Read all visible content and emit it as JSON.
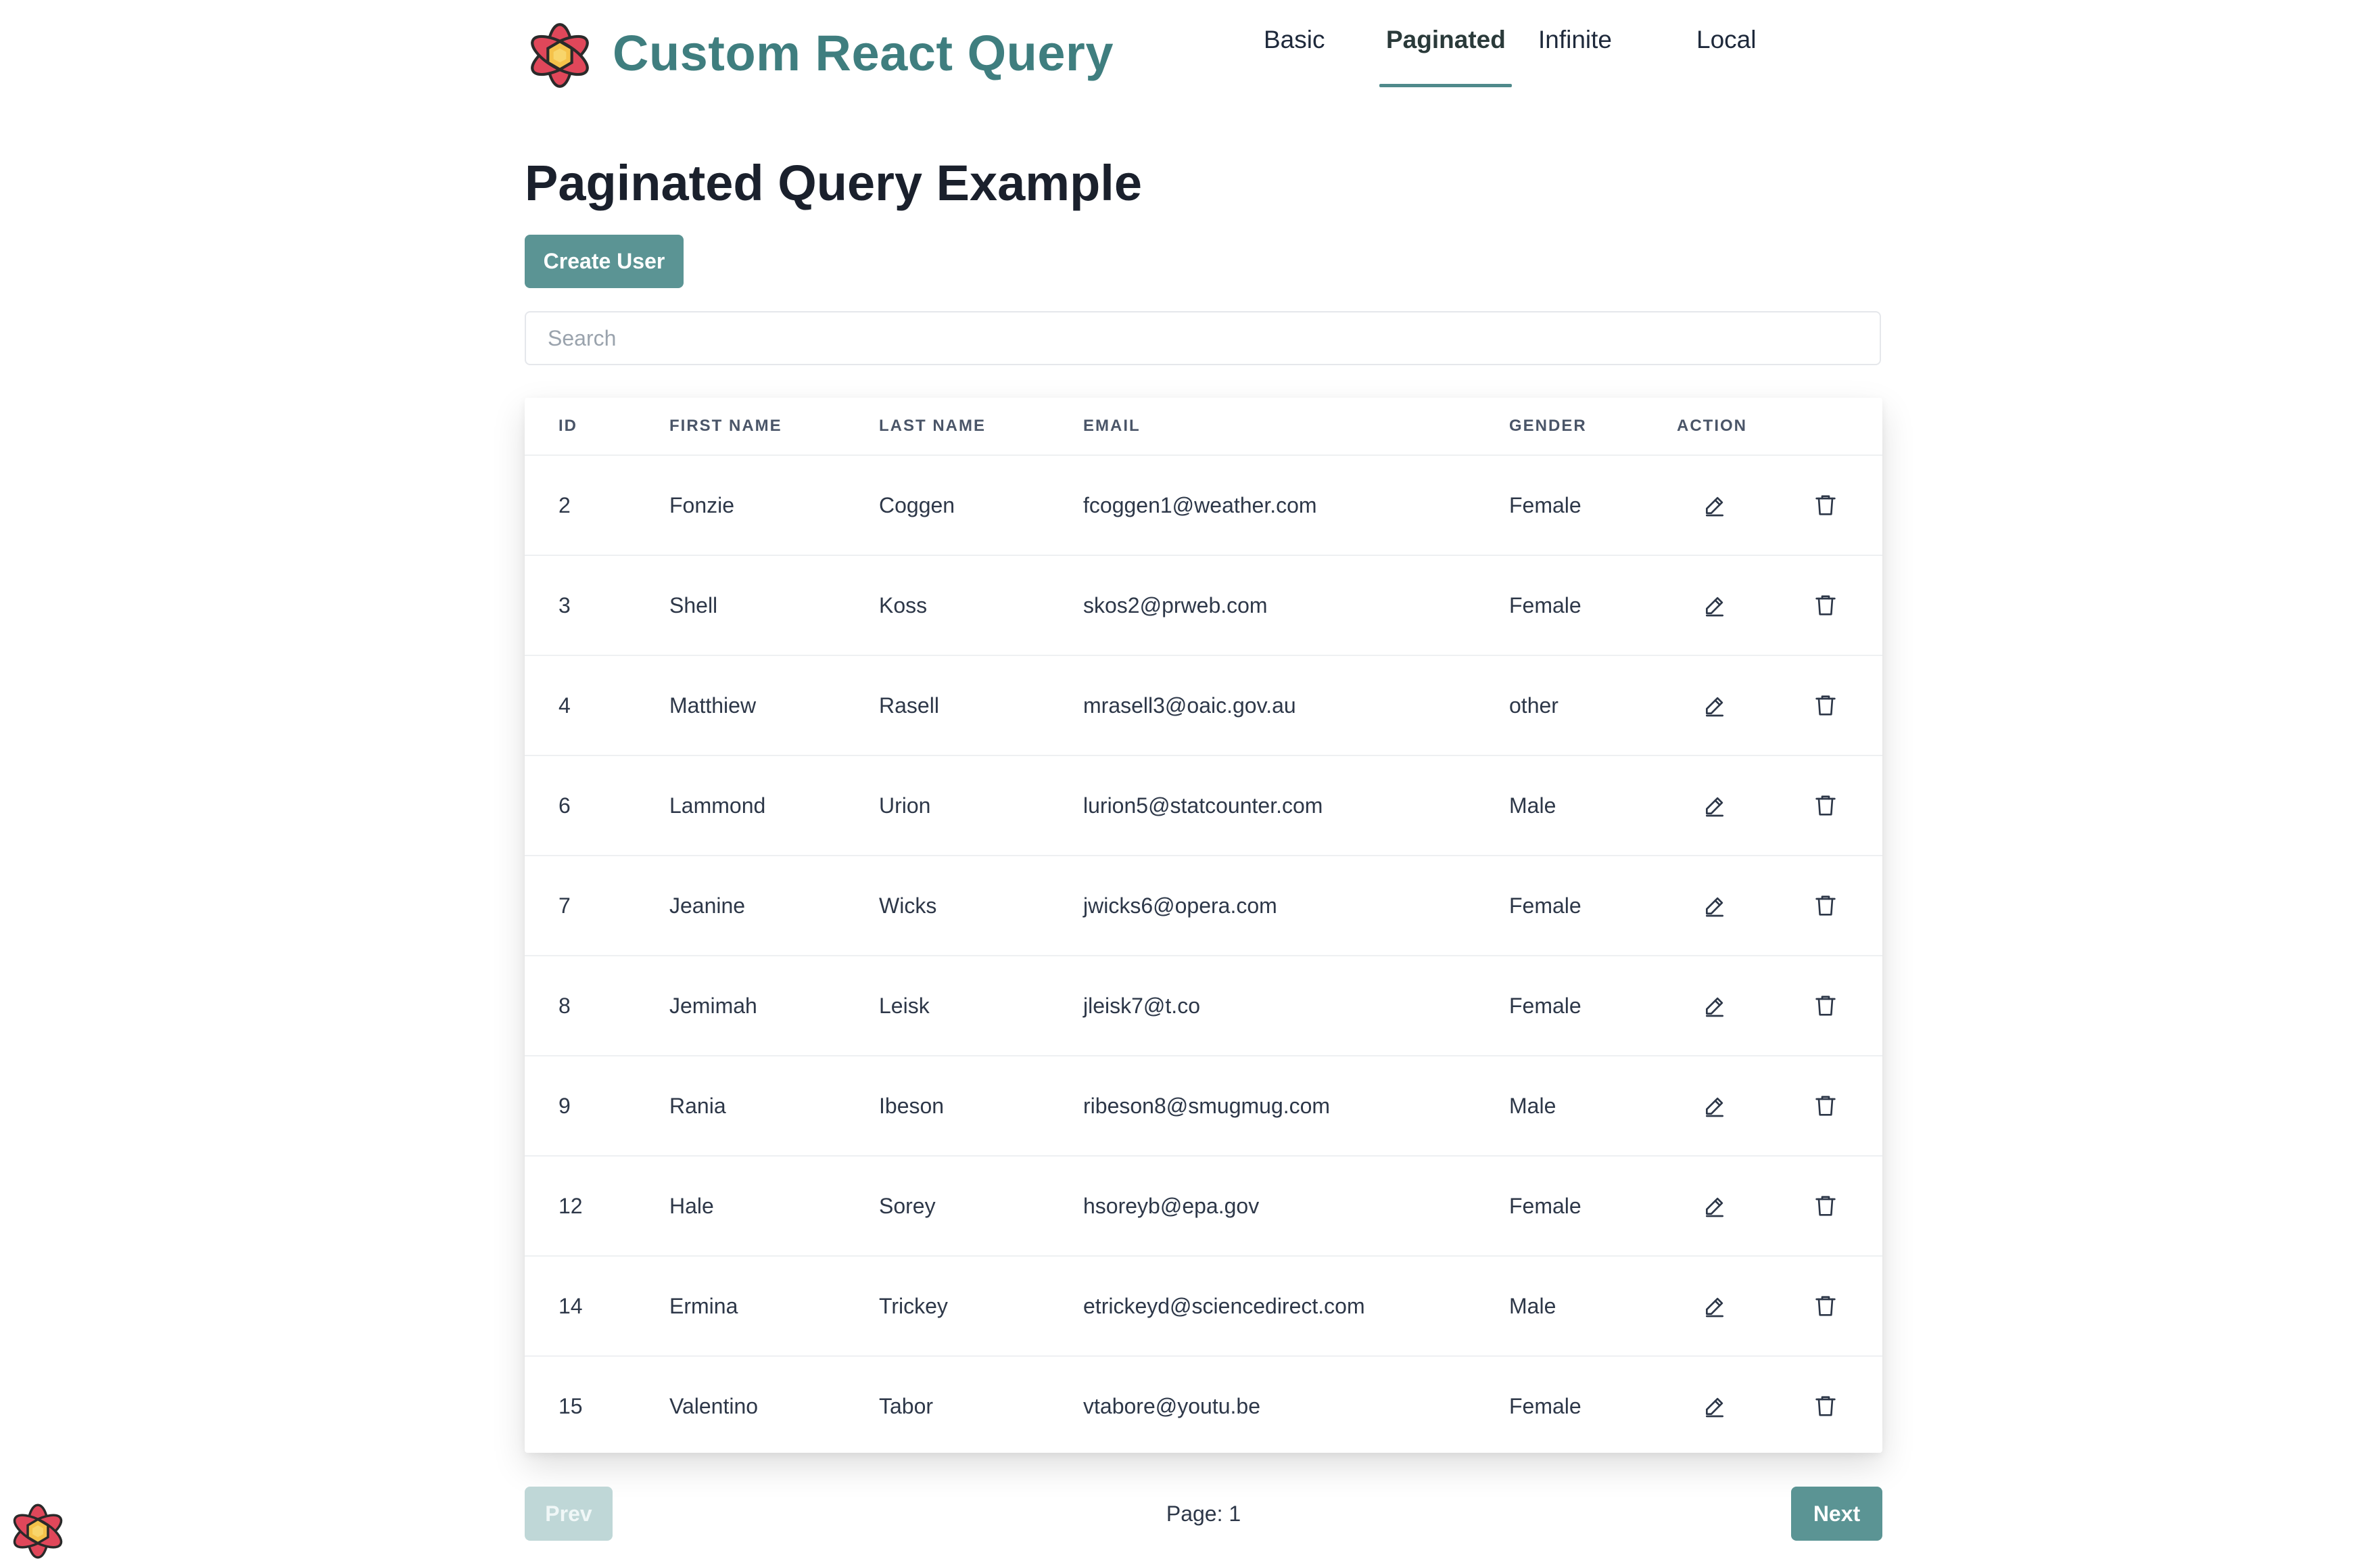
{
  "header": {
    "app_title": "Custom React Query",
    "logo_icon": "react-query-flower-logo"
  },
  "nav": {
    "items": [
      {
        "label": "Basic",
        "active": false
      },
      {
        "label": "Paginated",
        "active": true
      },
      {
        "label": "Infinite",
        "active": false
      },
      {
        "label": "Local",
        "active": false
      }
    ]
  },
  "main": {
    "page_title": "Paginated Query Example",
    "create_button_label": "Create User",
    "search_placeholder": "Search",
    "search_value": ""
  },
  "table": {
    "headers": [
      "ID",
      "FIRST NAME",
      "LAST NAME",
      "EMAIL",
      "GENDER",
      "ACTION"
    ],
    "rows": [
      {
        "id": "2",
        "first": "Fonzie",
        "last": "Coggen",
        "email": "fcoggen1@weather.com",
        "gender": "Female"
      },
      {
        "id": "3",
        "first": "Shell",
        "last": "Koss",
        "email": "skos2@prweb.com",
        "gender": "Female"
      },
      {
        "id": "4",
        "first": "Matthiew",
        "last": "Rasell",
        "email": "mrasell3@oaic.gov.au",
        "gender": "other"
      },
      {
        "id": "6",
        "first": "Lammond",
        "last": "Urion",
        "email": "lurion5@statcounter.com",
        "gender": "Male"
      },
      {
        "id": "7",
        "first": "Jeanine",
        "last": "Wicks",
        "email": "jwicks6@opera.com",
        "gender": "Female"
      },
      {
        "id": "8",
        "first": "Jemimah",
        "last": "Leisk",
        "email": "jleisk7@t.co",
        "gender": "Female"
      },
      {
        "id": "9",
        "first": "Rania",
        "last": "Ibeson",
        "email": "ribeson8@smugmug.com",
        "gender": "Male"
      },
      {
        "id": "12",
        "first": "Hale",
        "last": "Sorey",
        "email": "hsoreyb@epa.gov",
        "gender": "Female"
      },
      {
        "id": "14",
        "first": "Ermina",
        "last": "Trickey",
        "email": "etrickeyd@sciencedirect.com",
        "gender": "Male"
      },
      {
        "id": "15",
        "first": "Valentino",
        "last": "Tabor",
        "email": "vtabore@youtu.be",
        "gender": "Female"
      }
    ],
    "row_action_icons": [
      "pencil-icon",
      "trash-icon"
    ]
  },
  "pagination": {
    "prev_label": "Prev",
    "prev_disabled": true,
    "page_label": "Page: 1",
    "next_label": "Next"
  },
  "colors": {
    "brand": "#3f7e7f",
    "button": "#5b9494",
    "button_disabled": "#bfd7d7",
    "logo_petal": "#e0475a",
    "logo_center": "#f5c24a"
  }
}
